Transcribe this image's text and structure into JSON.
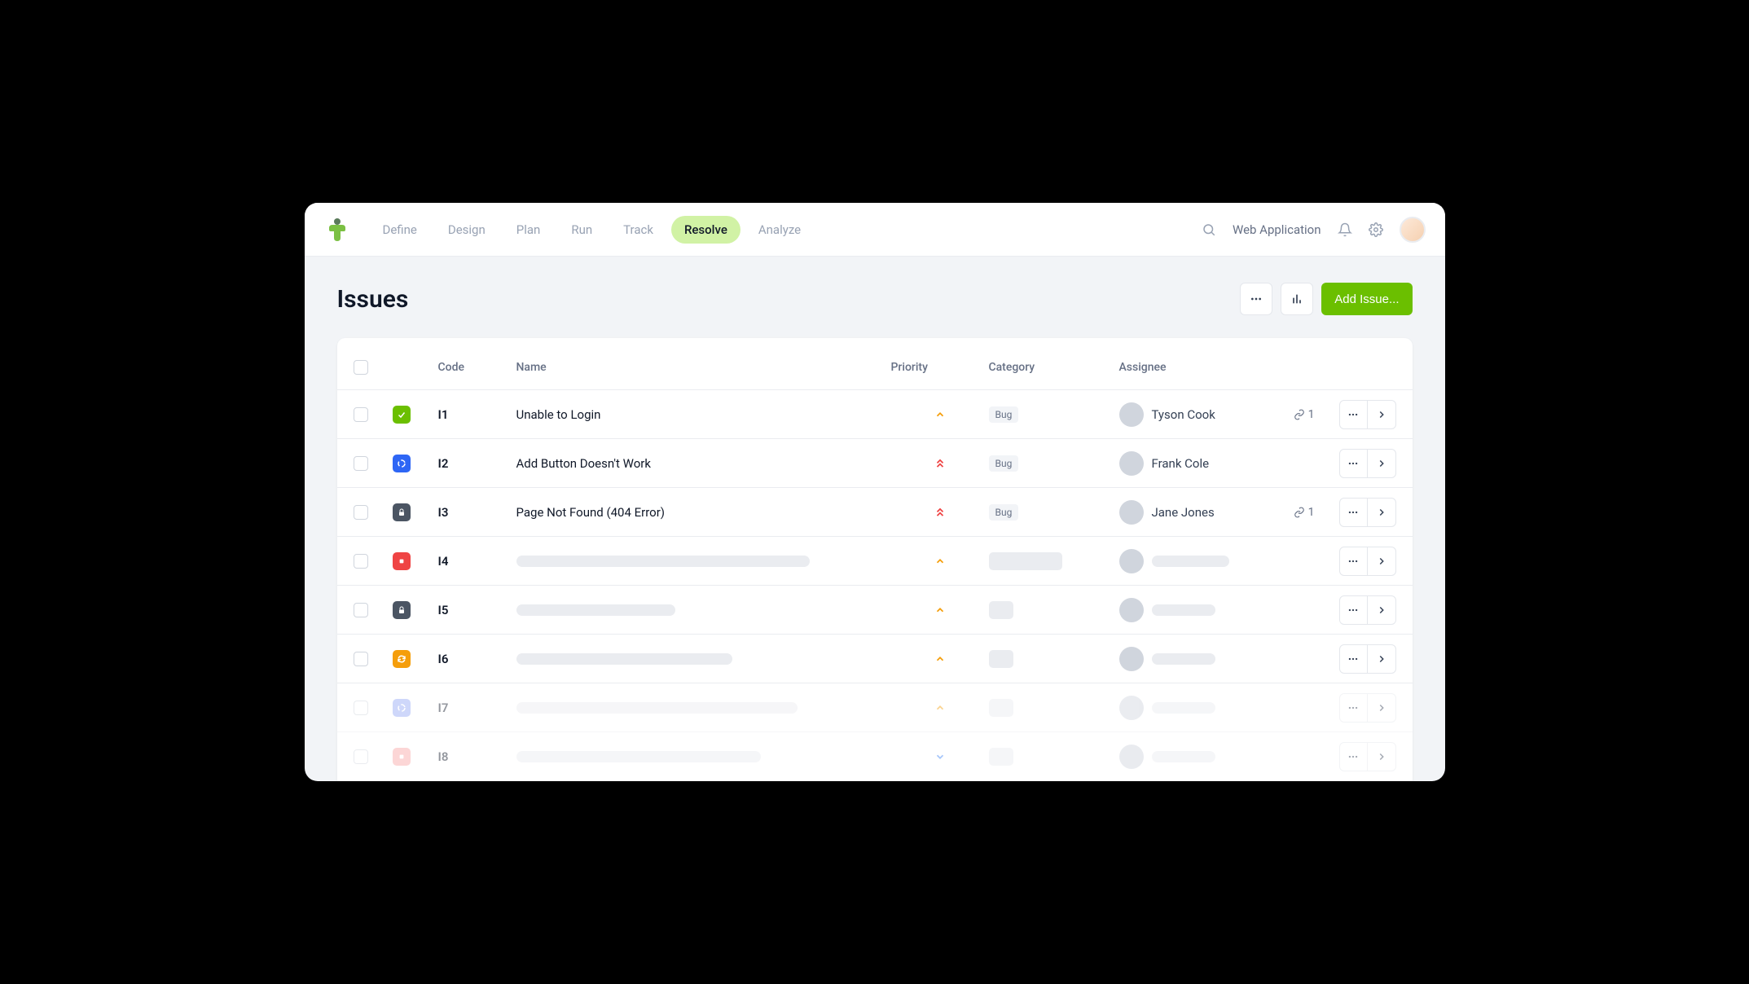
{
  "nav": {
    "tabs": [
      "Define",
      "Design",
      "Plan",
      "Run",
      "Track",
      "Resolve",
      "Analyze"
    ],
    "active": "Resolve",
    "project": "Web Application"
  },
  "page": {
    "title": "Issues",
    "add_button": "Add Issue..."
  },
  "table": {
    "headers": {
      "code": "Code",
      "name": "Name",
      "priority": "Priority",
      "category": "Category",
      "assignee": "Assignee"
    },
    "rows": [
      {
        "code": "I1",
        "name": "Unable to Login",
        "priority": "medium",
        "category": "Bug",
        "assignee": "Tyson Cook",
        "links": "1",
        "status": "check",
        "loaded": true
      },
      {
        "code": "I2",
        "name": "Add Button Doesn't Work",
        "priority": "high",
        "category": "Bug",
        "assignee": "Frank Cole",
        "links": null,
        "status": "loading",
        "loaded": true
      },
      {
        "code": "I3",
        "name": "Page Not Found (404 Error)",
        "priority": "high",
        "category": "Bug",
        "assignee": "Jane Jones",
        "links": "1",
        "status": "lock",
        "loaded": true
      },
      {
        "code": "I4",
        "name": null,
        "priority": "medium",
        "category": null,
        "assignee": null,
        "links": null,
        "status": "stop",
        "loaded": false,
        "nameWidth": 360,
        "catWidth": 90,
        "assWidth": 95
      },
      {
        "code": "I5",
        "name": null,
        "priority": "medium",
        "category": null,
        "assignee": null,
        "links": null,
        "status": "lock",
        "loaded": false,
        "nameWidth": 195,
        "catWidth": 30,
        "assWidth": 78
      },
      {
        "code": "I6",
        "name": null,
        "priority": "medium",
        "category": null,
        "assignee": null,
        "links": null,
        "status": "refresh",
        "loaded": false,
        "nameWidth": 265,
        "catWidth": 30,
        "assWidth": 78
      },
      {
        "code": "I7",
        "name": null,
        "priority": "medium",
        "category": null,
        "assignee": null,
        "links": null,
        "status": "loading2",
        "loaded": false,
        "nameWidth": 345,
        "catWidth": 30,
        "assWidth": 78,
        "faded": true
      },
      {
        "code": "I8",
        "name": null,
        "priority": "low",
        "category": null,
        "assignee": null,
        "links": null,
        "status": "stop2",
        "loaded": false,
        "nameWidth": 300,
        "catWidth": 30,
        "assWidth": 78,
        "faded": true
      }
    ]
  }
}
